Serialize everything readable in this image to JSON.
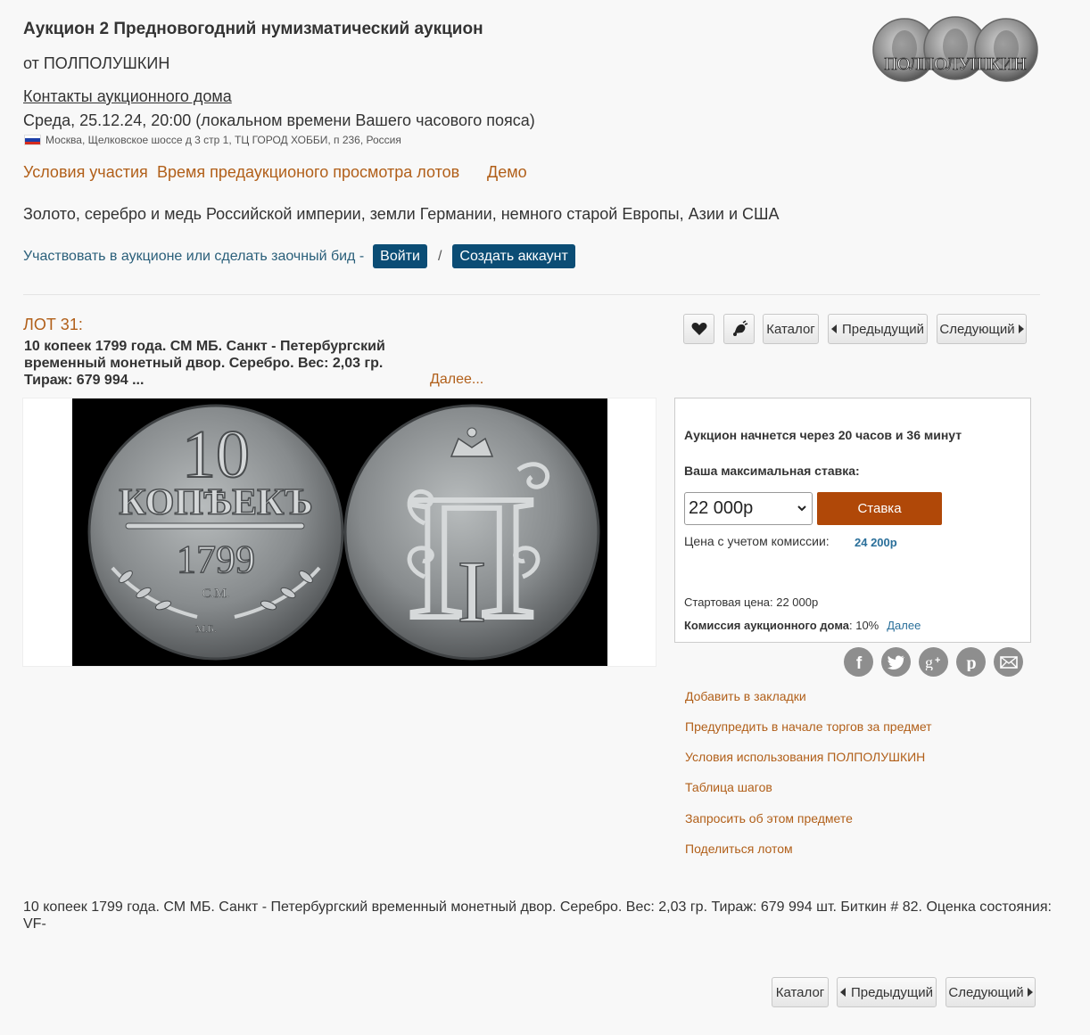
{
  "header": {
    "title": "Аукцион 2 Предновогодний нумизматический аукцион",
    "seller": "от ПОЛПОЛУШКИН",
    "contacts_link": "Контакты аукционного дома",
    "date": "Среда, 25.12.24, 20:00 (локальном времени Вашего часового пояса)",
    "address": "Москва, Щелковское шоссе д 3 стр 1, ТЦ ГОРОД ХОББИ, п 236, Россия",
    "logo_text": "ПОЛПОЛУШКИН"
  },
  "nav": {
    "conditions": "Условия участия",
    "preview": "Время предаукционого просмотра лотов",
    "demo": "Демо"
  },
  "description_header": "Золото, серебро и медь Российской империи, земли Германии, немного старой Европы, Азии и США",
  "participate": {
    "text": "Участвовать в аукционе или сделать заочный бид -",
    "login": "Войти",
    "separator": "/",
    "create_account": "Создать аккаунт"
  },
  "lot": {
    "number": "ЛОТ 31:",
    "title_line1": "10 копеек 1799 года. СМ МБ. Санкт - Петербургский",
    "title_line2": "временный монетный двор. Серебро. Вес: 2,03 гр.",
    "title_line3": "Тираж: 679 994 ...",
    "more": "Далее...",
    "full_description": "10 копеек 1799 года. СМ МБ. Санкт - Петербургский временный монетный двор. Серебро. Вес: 2,03 гр. Тираж: 679 994 шт. Биткин # 82. Оценка состояния: VF-"
  },
  "toolbar": {
    "catalog": "Каталог",
    "prev": "Предыдущий",
    "next": "Следующий"
  },
  "coin": {
    "denomination": "10",
    "word": "КОПѢЕКЪ",
    "year": "1799",
    "mint": "С.М.",
    "mint2": "М.Б.",
    "monogram": "П",
    "numeral": "I"
  },
  "bid": {
    "countdown": "Аукцион начнется через 20 часов и 36 минут",
    "max_label": "Ваша максимальная ставка:",
    "selected_value": "22 000р",
    "button": "Ставка",
    "commission_label": "Цена с учетом комиссии:",
    "commission_value": "24 200р",
    "start_price": "Стартовая цена: 22 000р",
    "house_commission_label": "Комиссия аукционного дома",
    "house_commission_value": ": 10%",
    "house_more": "Далее"
  },
  "share": [
    "facebook-icon",
    "twitter-icon",
    "google-plus-icon",
    "pinterest-icon",
    "mail-icon"
  ],
  "actions": {
    "bookmark": "Добавить в закладки",
    "notify": "Предупредить в начале торгов за предмет",
    "terms": "Условия использования ПОЛПОЛУШКИН",
    "steps": "Таблица шагов",
    "ask": "Запросить об этом предмете",
    "share_lot": "Поделиться лотом"
  },
  "colors": {
    "accent_orange": "#b15f19",
    "button_blue": "#0b4d75",
    "bid_button": "#b04808",
    "link_blue": "#2a6f9a"
  }
}
